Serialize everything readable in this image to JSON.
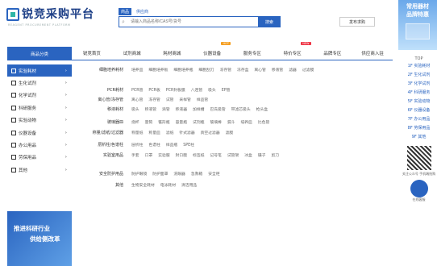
{
  "brand": {
    "name": "锐竞采购平台",
    "sub": "REAGENT PROCUREMENT PLATFORM"
  },
  "search": {
    "tabs": [
      "商品",
      "供应商"
    ],
    "placeholder": "请输入商品名称/CAS号/货号",
    "button": "搜索"
  },
  "publish": {
    "label": "发布求购"
  },
  "ad": {
    "line1": "常用器材",
    "line2": "品牌特惠"
  },
  "nav": {
    "category_label": "商品分类",
    "items": [
      {
        "label": "锐竞首页",
        "badge": ""
      },
      {
        "label": "试剂商城",
        "badge": ""
      },
      {
        "label": "耗材商城",
        "badge": ""
      },
      {
        "label": "仪器设备",
        "badge": "HOT"
      },
      {
        "label": "服务专区",
        "badge": ""
      },
      {
        "label": "特价专区",
        "badge": "NEW"
      },
      {
        "label": "品牌专区",
        "badge": ""
      },
      {
        "label": "供应商入驻",
        "badge": ""
      }
    ]
  },
  "sidebar": {
    "items": [
      {
        "label": "实验耗材"
      },
      {
        "label": "生化试剂"
      },
      {
        "label": "化学试剂"
      },
      {
        "label": "科研服务"
      },
      {
        "label": "实验动物"
      },
      {
        "label": "仪器设备"
      },
      {
        "label": "办公用品"
      },
      {
        "label": "劳保用品"
      },
      {
        "label": "其他"
      }
    ]
  },
  "promo": {
    "line1": "推进科研行业",
    "line2": "供给侧改革"
  },
  "content": {
    "rows": [
      {
        "label": "细胞培养耗材",
        "items": [
          "培养皿",
          "细胞培养板",
          "细胞培养瓶",
          "细胞刮刀",
          "冻存管",
          "冻存盒",
          "离心管",
          "移液管",
          "滤器",
          "过滤膜"
        ]
      },
      {
        "label": "PCR耗材",
        "items": [
          "PCR管",
          "PCR板",
          "PCR封板膜",
          "八连管",
          "吸头",
          "EP管"
        ]
      },
      {
        "label": "离心管/冻存管",
        "items": [
          "离心管",
          "冻存管",
          "试管",
          "采样管",
          "样品管"
        ]
      },
      {
        "label": "移液耗材",
        "items": [
          "吸头",
          "移液管",
          "滴管",
          "移液器",
          "加样槽",
          "巴氏吸管",
          "带滤芯吸头",
          "枪头盒"
        ]
      },
      {
        "label": "玻璃器皿",
        "items": [
          "烧杯",
          "量筒",
          "锥形瓶",
          "容量瓶",
          "试剂瓶",
          "玻璃棒",
          "漏斗",
          "培养皿",
          "比色管"
        ]
      },
      {
        "label": "称量/滤纸/过滤器",
        "items": [
          "称量纸",
          "称量皿",
          "滤纸",
          "针式滤器",
          "真空过滤器",
          "滤膜"
        ]
      },
      {
        "label": "层析柱/色谱柱",
        "items": [
          "层析柱",
          "色谱柱",
          "样品瓶",
          "SPE柱"
        ]
      },
      {
        "label": "实验室用品",
        "items": [
          "手套",
          "口罩",
          "实验服",
          "封口膜",
          "标签纸",
          "记号笔",
          "试管架",
          "冰盒",
          "镊子",
          "剪刀"
        ]
      },
      {
        "label": "安全防护用品",
        "items": [
          "防护眼镜",
          "防护面罩",
          "洗眼器",
          "急救箱",
          "安全柜"
        ]
      },
      {
        "label": "其他",
        "items": [
          "生物安全耗材",
          "电泳耗材",
          "清洁用品"
        ]
      }
    ]
  },
  "right_float": {
    "top": "TOP",
    "items": [
      "1F 实验耗材",
      "2F 生化试剂",
      "3F 化学试剂",
      "4F 科研服务",
      "5F 实验动物",
      "6F 仪器设备",
      "7F 办公用品",
      "8F 劳保用品",
      "9F 其他"
    ],
    "qr_text": "关注公众号 手机端抢购",
    "service": "在线客服"
  },
  "colors": {
    "primary": "#2a64c0",
    "accent": "#2eb6a6",
    "badge_hot": "#f59d1d",
    "badge_new": "#e34"
  }
}
